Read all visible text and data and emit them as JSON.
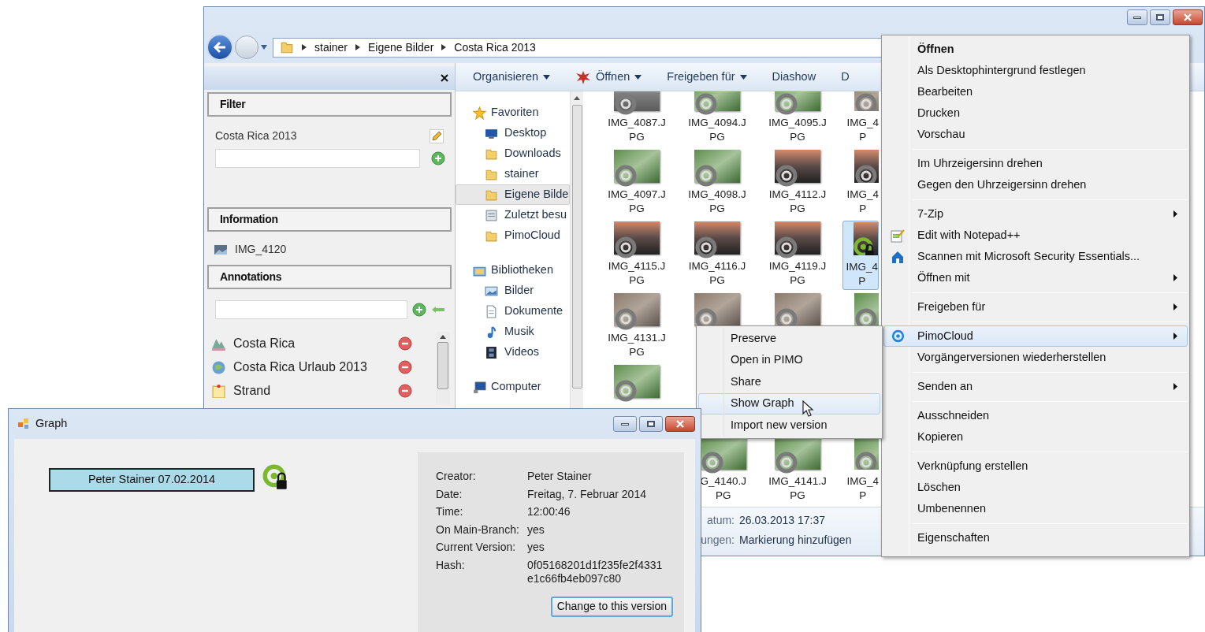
{
  "explorer": {
    "breadcrumbs": [
      "stainer",
      "Eigene Bilder",
      "Costa Rica 2013"
    ],
    "toolbar": [
      {
        "label": "Organisieren",
        "dropdown": true
      },
      {
        "label": "Öffnen",
        "dropdown": true
      },
      {
        "label": "Freigeben für",
        "dropdown": true
      },
      {
        "label": "Diashow",
        "dropdown": false
      },
      {
        "label": "D",
        "dropdown": false
      }
    ],
    "pimo_panel": {
      "filter": {
        "title": "Filter",
        "tag": "Costa Rica 2013"
      },
      "information": {
        "title": "Information",
        "file": "IMG_4120"
      },
      "annotations": {
        "title": "Annotations",
        "items": [
          {
            "label": "Costa Rica"
          },
          {
            "label": "Costa Rica Urlaub 2013"
          },
          {
            "label": "Strand"
          }
        ]
      }
    },
    "nav": [
      {
        "label": "Favoriten",
        "selected": false,
        "children": [
          {
            "label": "Desktop",
            "selected": false
          },
          {
            "label": "Downloads",
            "selected": false
          },
          {
            "label": "stainer",
            "selected": false
          },
          {
            "label": "Eigene Bilde",
            "selected": true
          },
          {
            "label": "Zuletzt besu",
            "selected": false
          },
          {
            "label": "PimoCloud",
            "selected": false
          }
        ]
      },
      {
        "label": "Bibliotheken",
        "selected": false,
        "children": [
          {
            "label": "Bilder",
            "selected": false
          },
          {
            "label": "Dokumente",
            "selected": false
          },
          {
            "label": "Musik",
            "selected": false
          },
          {
            "label": "Videos",
            "selected": false
          }
        ]
      },
      {
        "label": "Computer",
        "selected": false
      }
    ],
    "grid": [
      {
        "cells": [
          {
            "kind": "full",
            "lines": [
              "IMG_4087.J",
              "PG"
            ],
            "selected": false,
            "locked": false
          },
          {
            "kind": "full",
            "lines": [
              "IMG_4094.J",
              "PG"
            ],
            "selected": false,
            "locked": false
          },
          {
            "kind": "full",
            "lines": [
              "IMG_4095.J",
              "PG"
            ],
            "selected": false,
            "locked": false
          },
          {
            "kind": "cut_right",
            "lines": [
              "IMG_4",
              "P"
            ],
            "selected": false,
            "locked": false
          }
        ]
      },
      {
        "cells": [
          {
            "kind": "full",
            "lines": [
              "IMG_4097.J",
              "PG"
            ],
            "selected": false,
            "locked": false
          },
          {
            "kind": "full",
            "lines": [
              "IMG_4098.J",
              "PG"
            ],
            "selected": false,
            "locked": false
          },
          {
            "kind": "full",
            "lines": [
              "IMG_4112.J",
              "PG"
            ],
            "selected": false,
            "locked": false
          },
          {
            "kind": "cut_right",
            "lines": [
              "IMG_4",
              "P"
            ],
            "selected": false,
            "locked": false
          }
        ]
      },
      {
        "cells": [
          {
            "kind": "full",
            "lines": [
              "IMG_4115.J",
              "PG"
            ],
            "selected": false,
            "locked": false
          },
          {
            "kind": "full",
            "lines": [
              "IMG_4116.J",
              "PG"
            ],
            "selected": false,
            "locked": false
          },
          {
            "kind": "full",
            "lines": [
              "IMG_4119.J",
              "PG"
            ],
            "selected": false,
            "locked": false
          },
          {
            "kind": "cut_right",
            "lines": [
              "IMG_4",
              "P"
            ],
            "selected": true,
            "locked": true
          }
        ]
      },
      {
        "cells": [
          {
            "kind": "full",
            "lines": [
              "IMG_4131.J",
              "PG"
            ],
            "selected": false,
            "locked": false
          },
          {
            "kind": "full",
            "selected": false,
            "locked": false
          },
          {
            "kind": "full",
            "selected": false,
            "locked": false
          },
          {
            "kind": "cut_right",
            "selected": false,
            "locked": false
          }
        ]
      },
      {
        "cells": [
          {
            "kind": "full",
            "selected": false,
            "locked": false
          },
          {
            "kind": "empty"
          },
          {
            "kind": "empty"
          },
          {
            "kind": "empty"
          }
        ]
      },
      {
        "cells": [
          {
            "kind": "empty"
          },
          {
            "kind": "cut_left",
            "lines": [
              "G_4140.J",
              "PG"
            ],
            "selected": false,
            "locked": false
          },
          {
            "kind": "full",
            "lines": [
              "IMG_4141.J",
              "PG"
            ],
            "selected": false,
            "locked": false
          },
          {
            "kind": "cut_right",
            "lines": [
              "IMG_4",
              "P"
            ],
            "selected": false,
            "locked": false
          }
        ]
      }
    ],
    "details": [
      {
        "label": "atum:",
        "value": "26.03.2013 17:37"
      },
      {
        "label": "ungen:",
        "value": "Markierung hinzufügen"
      }
    ]
  },
  "context_menu": [
    [
      {
        "label": "Öffnen",
        "default": true,
        "submenu": false,
        "selected": false
      },
      {
        "label": "Als Desktophintergrund festlegen",
        "default": false,
        "submenu": false,
        "selected": false
      },
      {
        "label": "Bearbeiten",
        "default": false,
        "submenu": false,
        "selected": false
      },
      {
        "label": "Drucken",
        "default": false,
        "submenu": false,
        "selected": false
      },
      {
        "label": "Vorschau",
        "default": false,
        "submenu": false,
        "selected": false
      }
    ],
    [
      {
        "label": "Im Uhrzeigersinn drehen",
        "default": false,
        "submenu": false,
        "selected": false
      },
      {
        "label": "Gegen den Uhrzeigersinn drehen",
        "default": false,
        "submenu": false,
        "selected": false
      }
    ],
    [
      {
        "label": "7-Zip",
        "default": false,
        "submenu": true,
        "selected": false
      },
      {
        "label": "Edit with Notepad++",
        "default": false,
        "submenu": false,
        "selected": false
      },
      {
        "label": "Scannen mit Microsoft Security Essentials...",
        "default": false,
        "submenu": false,
        "selected": false
      },
      {
        "label": "Öffnen mit",
        "default": false,
        "submenu": true,
        "selected": false
      }
    ],
    [
      {
        "label": "Freigeben für",
        "default": false,
        "submenu": true,
        "selected": false
      }
    ],
    [
      {
        "label": "PimoCloud",
        "default": false,
        "submenu": true,
        "selected": true
      },
      {
        "label": "Vorgängerversionen wiederherstellen",
        "default": false,
        "submenu": false,
        "selected": false
      }
    ],
    [
      {
        "label": "Senden an",
        "default": false,
        "submenu": true,
        "selected": false
      }
    ],
    [
      {
        "label": "Ausschneiden",
        "default": false,
        "submenu": false,
        "selected": false
      },
      {
        "label": "Kopieren",
        "default": false,
        "submenu": false,
        "selected": false
      }
    ],
    [
      {
        "label": "Verknüpfung erstellen",
        "default": false,
        "submenu": false,
        "selected": false
      },
      {
        "label": "Löschen",
        "default": false,
        "submenu": false,
        "selected": false
      },
      {
        "label": "Umbenennen",
        "default": false,
        "submenu": false,
        "selected": false
      }
    ],
    [
      {
        "label": "Eigenschaften",
        "default": false,
        "submenu": false,
        "selected": false
      }
    ]
  ],
  "submenu": [
    {
      "label": "Preserve",
      "selected": false
    },
    {
      "label": "Open in PIMO",
      "selected": false
    },
    {
      "label": "Share",
      "selected": false
    },
    {
      "label": "Show Graph",
      "selected": true
    },
    {
      "label": "Import new version",
      "selected": false
    }
  ],
  "graph_window": {
    "title": "Graph",
    "node": {
      "label": "Peter Stainer 07.02.2014",
      "locked": true
    },
    "info": [
      {
        "label": "Creator:",
        "value": "Peter Stainer"
      },
      {
        "label": "Date:",
        "value": "Freitag, 7. Februar 2014"
      },
      {
        "label": "Time:",
        "value": "12:00:46"
      },
      {
        "label": "On Main-Branch:",
        "value": "yes"
      },
      {
        "label": "Current Version:",
        "value": "yes"
      },
      {
        "label": "Hash:",
        "value": "0f05168201d1f235fe2f4331e1c66fb4eb097c80"
      }
    ],
    "button": "Change to this version"
  }
}
